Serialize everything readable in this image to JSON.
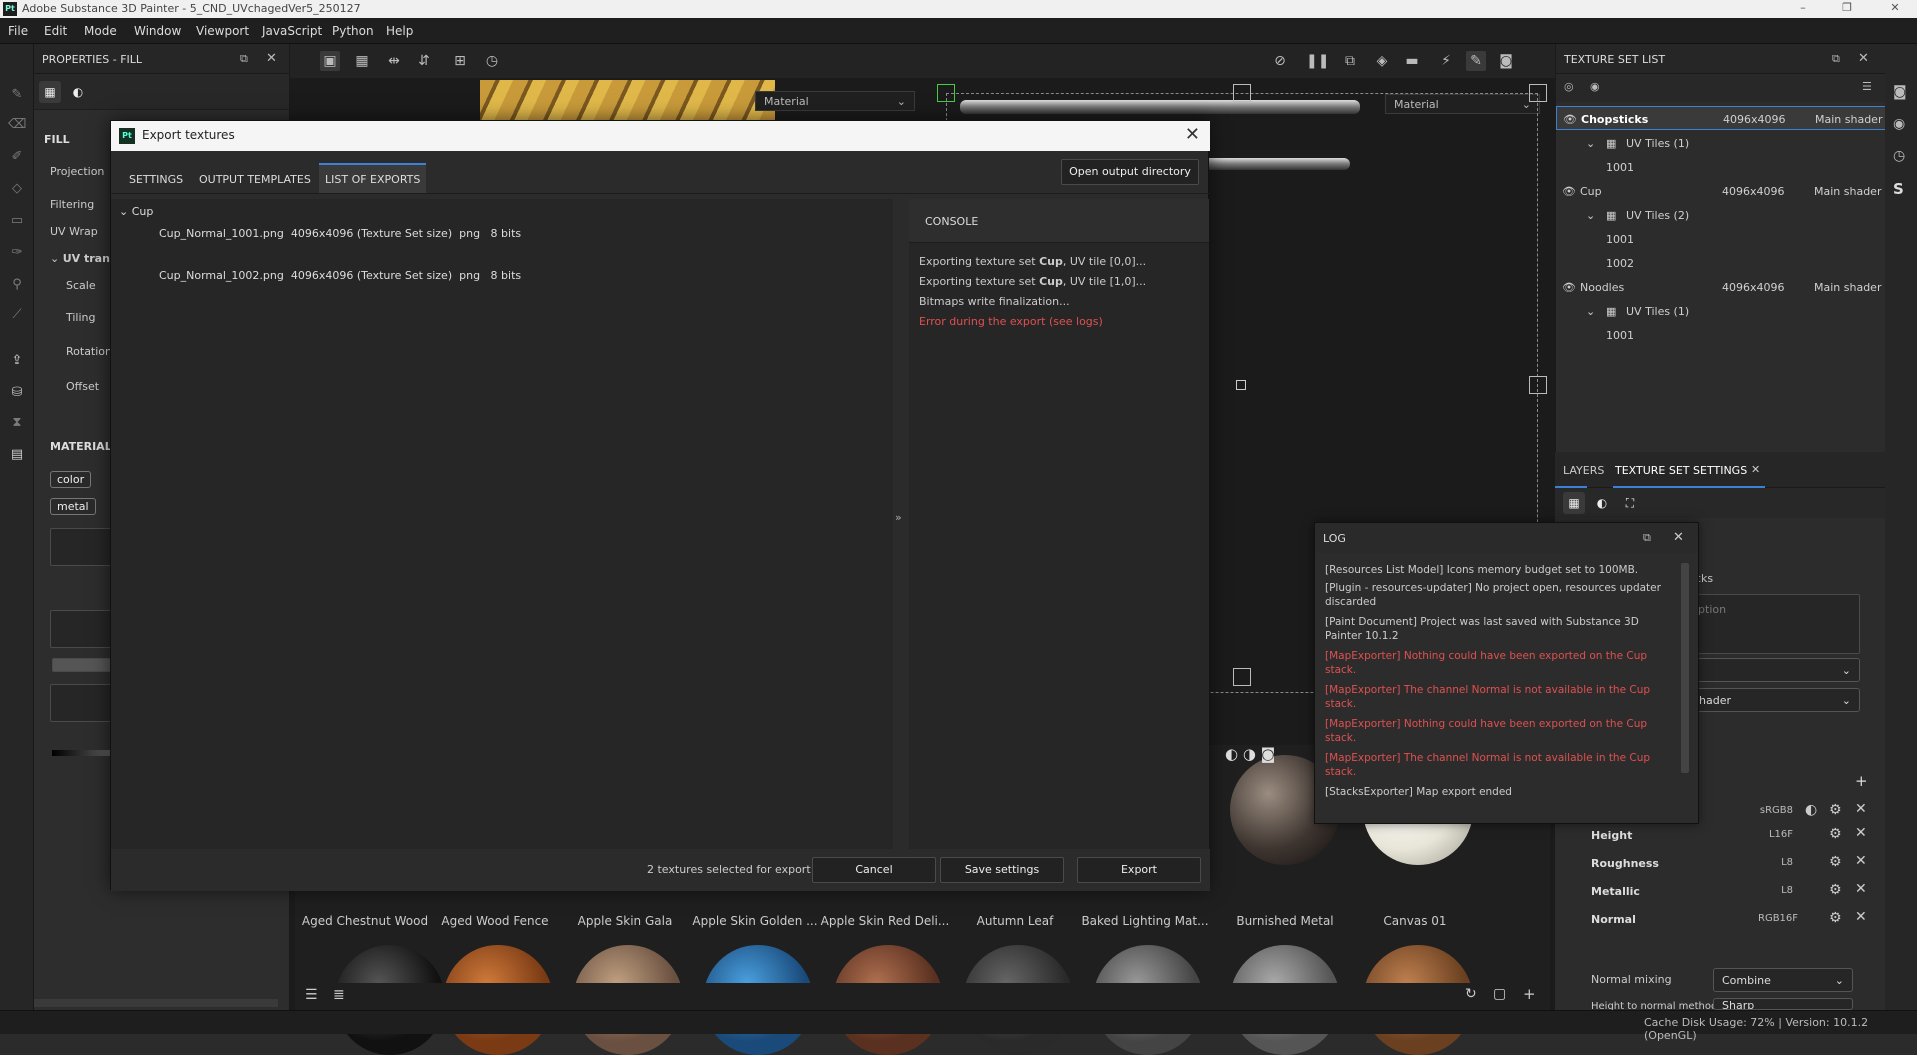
{
  "window": {
    "title": "Adobe Substance 3D Painter - 5_CND_UVchagedVer5_250127",
    "logo": "Pt",
    "controls": [
      "–",
      "❐",
      "✕"
    ]
  },
  "menu": [
    "File",
    "Edit",
    "Mode",
    "Window",
    "Viewport",
    "JavaScript",
    "Python",
    "Help"
  ],
  "properties": {
    "title": "PROPERTIES - FILL",
    "section_fill": "FILL",
    "fields": [
      "Projection",
      "Filtering",
      "UV Wrap"
    ],
    "uv_group": "UV trans",
    "uv_fields": [
      "Scale",
      "Tiling",
      "Rotation",
      "Offset"
    ],
    "section_material": "MATERIAL",
    "chips": [
      "color",
      "metal"
    ]
  },
  "viewport": {
    "material_dropdown_1": "Material",
    "material_dropdown_2": "Material"
  },
  "texture_set_list": {
    "title": "TEXTURE SET LIST",
    "sets": [
      {
        "name": "Chopsticks",
        "size": "4096x4096",
        "shader": "Main shader",
        "uv_label": "UV Tiles (1)",
        "tiles": [
          "1001"
        ]
      },
      {
        "name": "Cup",
        "size": "4096x4096",
        "shader": "Main shader",
        "uv_label": "UV Tiles (2)",
        "tiles": [
          "1001",
          "1002"
        ]
      },
      {
        "name": "Noodles",
        "size": "4096x4096",
        "shader": "Main shader",
        "uv_label": "UV Tiles (1)",
        "tiles": [
          "1001"
        ]
      }
    ]
  },
  "layers_panel": {
    "tab_layers": "LAYERS",
    "tab_tss": "TEXTURE SET SETTINGS",
    "partial_stacks": "cks",
    "partial_description": "iption",
    "partial_shader": "hader",
    "channels": [
      {
        "name": "",
        "format": "sRGB8"
      },
      {
        "name": "Height",
        "format": "L16F"
      },
      {
        "name": "Roughness",
        "format": "L8"
      },
      {
        "name": "Metallic",
        "format": "L8"
      },
      {
        "name": "Normal",
        "format": "RGB16F"
      }
    ],
    "normal_mixing_label": "Normal mixing",
    "normal_mixing_value": "Combine",
    "height_to_normal_label": "Height to normal method",
    "height_to_normal_value": "Sharp"
  },
  "shelf": {
    "materials": [
      "Aged Chestnut Wood",
      "Aged Wood Fence",
      "Apple Skin Gala",
      "Apple Skin Golden ...",
      "Apple Skin Red Deli...",
      "Autumn Leaf",
      "Baked Lighting Mat...",
      "Burnished Metal",
      "Canvas 01"
    ]
  },
  "status": {
    "text": "Cache Disk Usage:   72% | Version: 10.1.2 (OpenGL)"
  },
  "export_dialog": {
    "title": "Export textures",
    "tabs": [
      "SETTINGS",
      "OUTPUT TEMPLATES",
      "LIST OF EXPORTS"
    ],
    "open_dir": "Open output directory",
    "group": "Cup",
    "files": [
      {
        "name": "Cup_Normal_1001.png",
        "size": "4096x4096 (Texture Set size)",
        "format": "png",
        "depth": "8 bits"
      },
      {
        "name": "Cup_Normal_1002.png",
        "size": "4096x4096 (Texture Set size)",
        "format": "png",
        "depth": "8 bits"
      }
    ],
    "console_title": "CONSOLE",
    "console_lines": [
      {
        "pre": "Exporting texture set ",
        "bold": "Cup",
        "post": ", UV tile [0,0]..."
      },
      {
        "pre": "Exporting texture set ",
        "bold": "Cup",
        "post": ", UV tile [1,0]..."
      },
      {
        "pre": "Bitmaps write finalization...",
        "bold": "",
        "post": ""
      }
    ],
    "console_error": "Error during the export (see logs)",
    "selected_count": "2 textures selected for export",
    "cancel": "Cancel",
    "save_settings": "Save settings",
    "export": "Export"
  },
  "log": {
    "title": "LOG",
    "lines": [
      {
        "text": "[Resources List Model] Icons memory budget set to 100MB.",
        "error": false
      },
      {
        "text": "[Plugin - resources-updater] No project open, resources updater discarded",
        "error": false
      },
      {
        "text": "[Paint Document] Project was last saved with Substance 3D Painter 10.1.2",
        "error": false
      },
      {
        "text": "[MapExporter] Nothing could have been exported on the Cup stack.",
        "error": true
      },
      {
        "text": "[MapExporter]      The channel Normal is not available in the Cup stack.",
        "error": true
      },
      {
        "text": "[MapExporter] Nothing could have been exported on the Cup stack.",
        "error": true
      },
      {
        "text": "[MapExporter]      The channel Normal is not available in the Cup stack.",
        "error": true
      },
      {
        "text": "[StacksExporter] Map export ended",
        "error": false
      }
    ]
  }
}
